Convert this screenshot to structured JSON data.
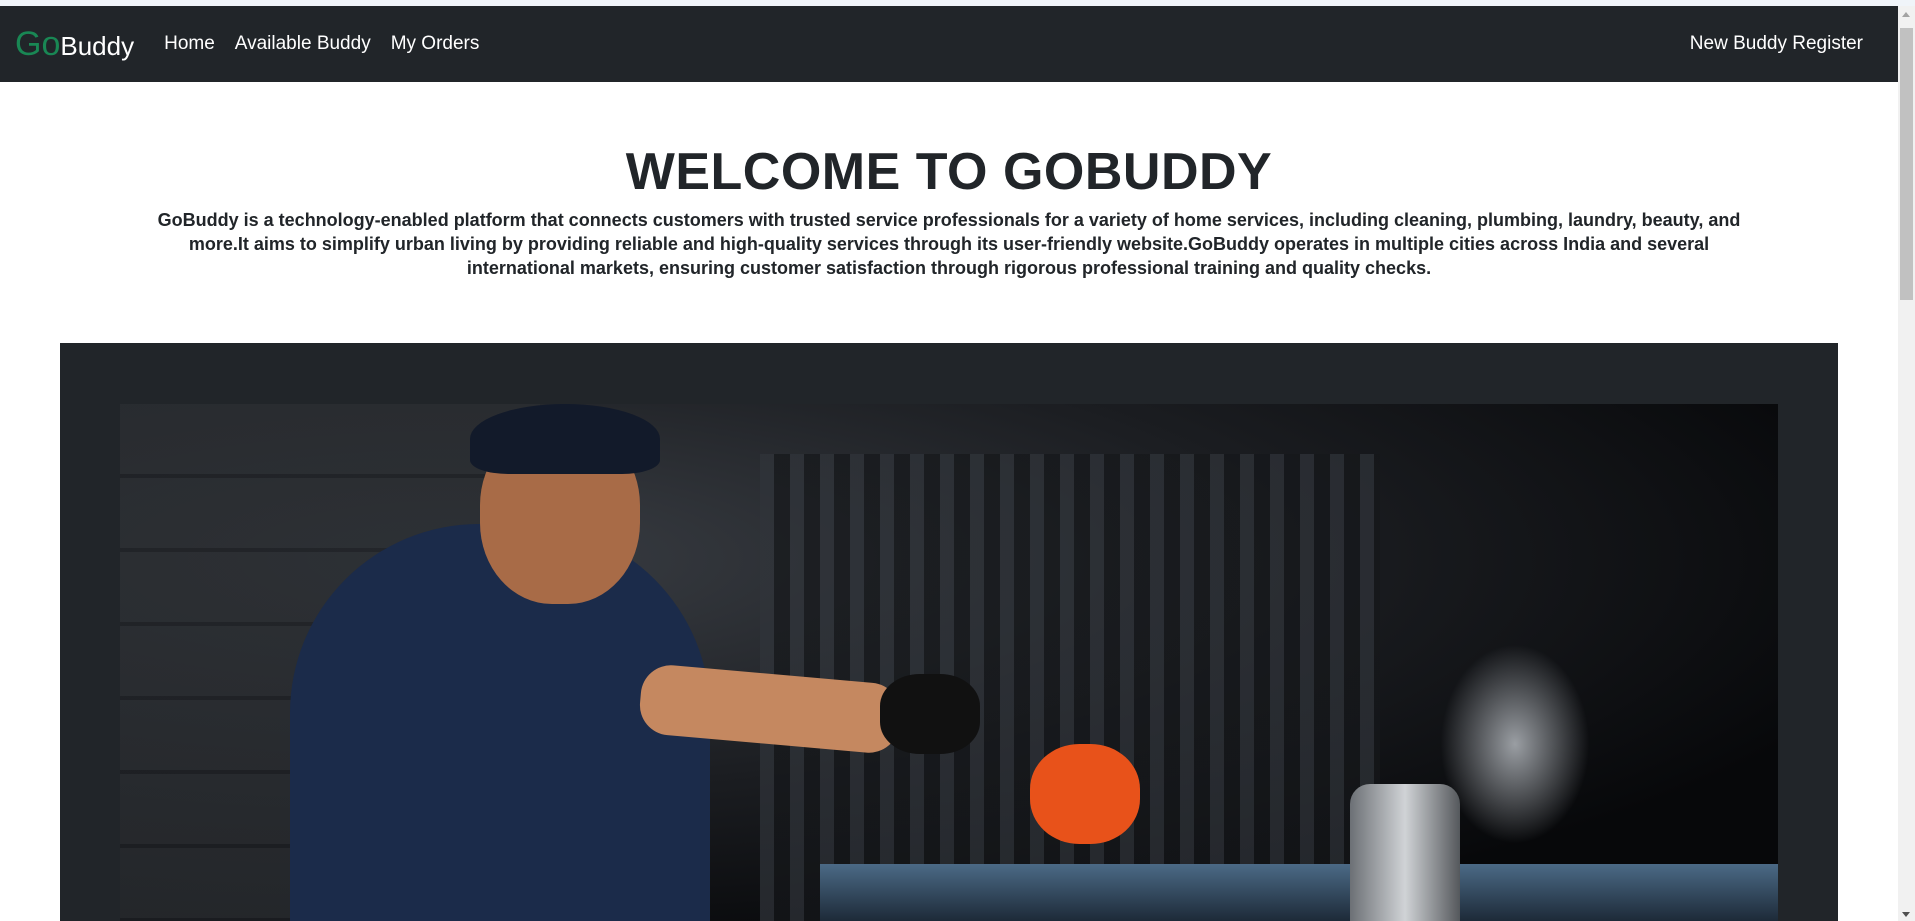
{
  "navbar": {
    "brand_go": "Go",
    "brand_buddy": "Buddy",
    "links": [
      "Home",
      "Available Buddy",
      "My Orders"
    ],
    "register_label": "New Buddy Register",
    "brand_accent_color": "#198754",
    "background_color": "#212529"
  },
  "hero": {
    "title": "WELCOME TO GOBUDDY",
    "description": "GoBuddy is a technology-enabled platform that connects customers with trusted service professionals for a variety of home services, including cleaning, plumbing, laundry, beauty, and more.It aims to simplify urban living by providing reliable and high-quality services through its user-friendly website.GoBuddy operates in multiple cities across India and several international markets, ensuring customer satisfaction through rigorous professional training and quality checks."
  },
  "showcase": {
    "image": "chef-cooking-photo"
  }
}
